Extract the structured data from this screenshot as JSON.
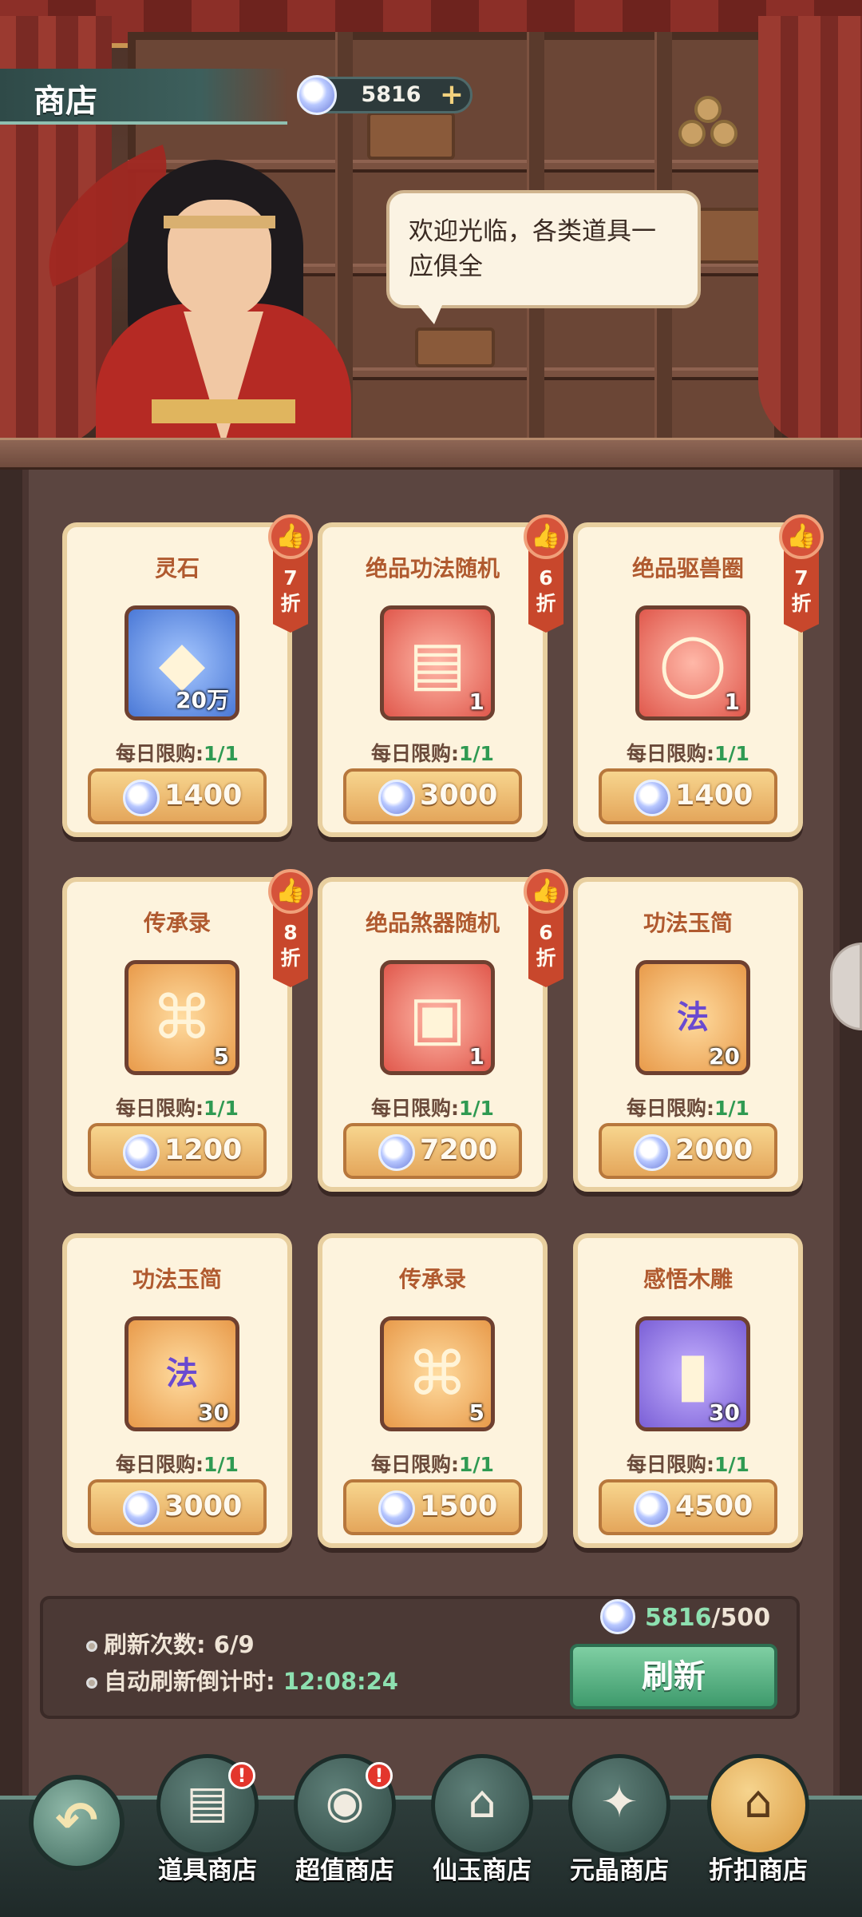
{
  "header": {
    "title": "商店",
    "currency": {
      "icon": "jade-coin-icon",
      "amount": "5816",
      "add": "+"
    }
  },
  "npc": {
    "greeting": "欢迎光临，各类道具一应俱全"
  },
  "shop": {
    "cards": [
      {
        "name": "灵石",
        "icon": "crystal-icon",
        "tile": "blue",
        "glyph": "◆",
        "quantity": "20万",
        "limit_label": "每日限购:",
        "limit_count": "1/1",
        "price": "1400",
        "discount": [
          "7",
          "折"
        ]
      },
      {
        "name": "绝品功法随机",
        "icon": "technique-book-icon",
        "tile": "red",
        "glyph": "▤",
        "quantity": "1",
        "limit_label": "每日限购:",
        "limit_count": "1/1",
        "price": "3000",
        "discount": [
          "6",
          "折"
        ]
      },
      {
        "name": "绝品驱兽圈",
        "icon": "beast-ring-icon",
        "tile": "red",
        "glyph": "◯",
        "quantity": "1",
        "limit_label": "每日限购:",
        "limit_count": "1/1",
        "price": "1400",
        "discount": [
          "7",
          "折"
        ]
      },
      {
        "name": "传承录",
        "icon": "scroll-icon",
        "tile": "orange",
        "glyph": "⌘",
        "quantity": "5",
        "limit_label": "每日限购:",
        "limit_count": "1/1",
        "price": "1200",
        "discount": [
          "8",
          "折"
        ]
      },
      {
        "name": "绝品煞器随机",
        "icon": "treasure-chest-icon",
        "tile": "red",
        "glyph": "▣",
        "quantity": "1",
        "limit_label": "每日限购:",
        "limit_count": "1/1",
        "price": "7200",
        "discount": [
          "6",
          "折"
        ]
      },
      {
        "name": "功法玉简",
        "icon": "jade-slip-icon",
        "tile": "orange",
        "glyph": "法",
        "quantity": "20",
        "limit_label": "每日限购:",
        "limit_count": "1/1",
        "price": "2000",
        "discount": null
      },
      {
        "name": "功法玉简",
        "icon": "jade-slip-icon",
        "tile": "orange",
        "glyph": "法",
        "quantity": "30",
        "limit_label": "每日限购:",
        "limit_count": "1/1",
        "price": "3000",
        "discount": null
      },
      {
        "name": "传承录",
        "icon": "scroll-icon",
        "tile": "orange",
        "glyph": "⌘",
        "quantity": "5",
        "limit_label": "每日限购:",
        "limit_count": "1/1",
        "price": "1500",
        "discount": null
      },
      {
        "name": "感悟木雕",
        "icon": "wood-carving-icon",
        "tile": "purple",
        "glyph": "▮",
        "quantity": "30",
        "limit_label": "每日限购:",
        "limit_count": "1/1",
        "price": "4500",
        "discount": null
      }
    ]
  },
  "refresh": {
    "times_label": "刷新次数: ",
    "times_value": "6/9",
    "countdown_label": "自动刷新倒计时: ",
    "countdown_value": "12:08:24",
    "cost_have": "5816",
    "cost_need": "/500",
    "button_label": "刷新"
  },
  "nav": {
    "back": "↶",
    "items": [
      {
        "label": "道具商店",
        "icon": "item-chest-icon",
        "glyph": "▤",
        "alert": "!",
        "active": false
      },
      {
        "label": "超值商店",
        "icon": "money-bag-icon",
        "glyph": "◉",
        "alert": "!",
        "active": false
      },
      {
        "label": "仙玉商店",
        "icon": "pavilion-icon",
        "glyph": "⌂",
        "alert": null,
        "active": false
      },
      {
        "label": "元晶商店",
        "icon": "crystal-cluster-icon",
        "glyph": "✦",
        "alert": null,
        "active": false
      },
      {
        "label": "折扣商店",
        "icon": "discount-shop-icon",
        "glyph": "⌂",
        "alert": null,
        "active": true
      }
    ]
  }
}
